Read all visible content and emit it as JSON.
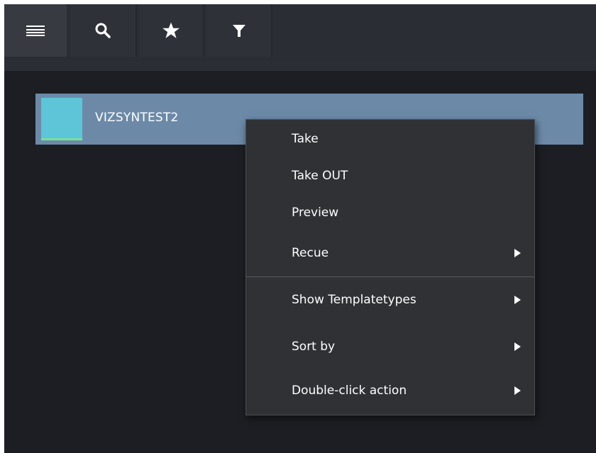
{
  "toolbar": {
    "buttons": [
      {
        "icon": "hamburger-menu-icon",
        "active": true
      },
      {
        "icon": "search-icon",
        "active": false
      },
      {
        "icon": "star-icon",
        "active": false
      },
      {
        "icon": "filter-icon",
        "active": false
      }
    ]
  },
  "list": {
    "items": [
      {
        "label": "VIZSYNTEST2",
        "thumbnail_color": "#5ec4d8",
        "status_color": "#76e29a",
        "selected": true
      }
    ]
  },
  "context_menu": {
    "items": [
      {
        "label": "Take"
      },
      {
        "label": "Take OUT"
      },
      {
        "label": "Preview"
      },
      {
        "label": "Recue",
        "submenu": true
      },
      {
        "label": "Show Templatetypes",
        "submenu": true
      },
      {
        "label": "Sort by",
        "submenu": true
      },
      {
        "label": "Double-click action",
        "submenu": true
      }
    ]
  },
  "colors": {
    "selection": "#6c8aa8",
    "menu_background": "#2f3135",
    "app_background": "#1c1e23"
  }
}
